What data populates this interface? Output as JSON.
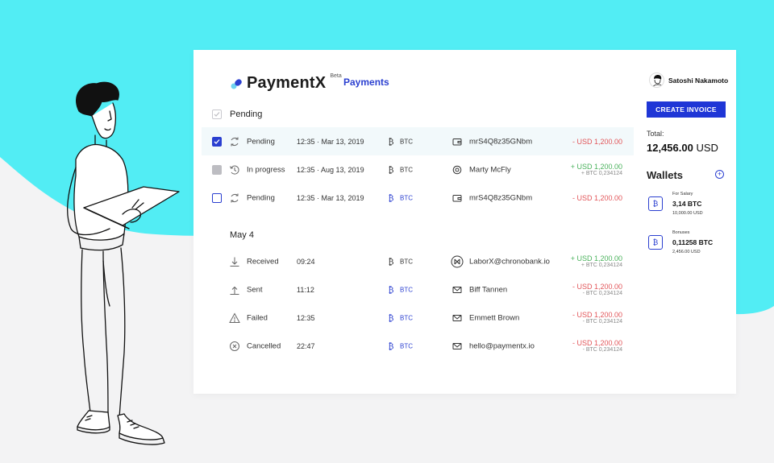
{
  "app": {
    "name": "PaymentX",
    "badge": "Beta",
    "nav_active": "Payments"
  },
  "groups": [
    {
      "title": "Pending"
    },
    {
      "title": "May 4"
    }
  ],
  "pending_rows": [
    {
      "status": "Pending",
      "time": "12:35 · Mar 13, 2019",
      "currency": "BTC",
      "party": "mrS4Q8z35GNbm",
      "amount": "- USD 1,200.00",
      "sub": ""
    },
    {
      "status": "In progress",
      "time": "12:35 · Aug 13, 2019",
      "currency": "BTC",
      "party": "Marty McFly",
      "amount": "+ USD 1,200.00",
      "sub": "+ BTC 0,234124"
    },
    {
      "status": "Pending",
      "time": "12:35 · Mar 13, 2019",
      "currency": "BTC",
      "party": "mrS4Q8z35GNbm",
      "amount": "- USD 1,200.00",
      "sub": ""
    }
  ],
  "may_rows": [
    {
      "status": "Received",
      "time": "09:24",
      "currency": "BTC",
      "party": "LaborX@chronobank.io",
      "amount": "+ USD 1,200.00",
      "sub": "+ BTC 0,234124"
    },
    {
      "status": "Sent",
      "time": "11:12",
      "currency": "BTC",
      "party": "Biff Tannen",
      "amount": "- USD 1,200.00",
      "sub": "- BTC 0,234124"
    },
    {
      "status": "Failed",
      "time": "12:35",
      "currency": "BTC",
      "party": "Emmett Brown",
      "amount": "- USD 1,200.00",
      "sub": "- BTC 0,234124"
    },
    {
      "status": "Cancelled",
      "time": "22:47",
      "currency": "BTC",
      "party": "hello@paymentx.io",
      "amount": "- USD 1,200.00",
      "sub": "- BTC 0,234124"
    }
  ],
  "sidebar": {
    "user_name": "Satoshi Nakamoto",
    "create_invoice": "CREATE INVOICE",
    "total_label": "Total:",
    "total_value": "12,456.00",
    "total_unit": "USD",
    "wallets_title": "Wallets",
    "add_symbol": "+",
    "wallets": [
      {
        "name": "For Salary",
        "amount": "3,14 BTC",
        "usd": "10,000.00 USD"
      },
      {
        "name": "Bonuses",
        "amount": "0,11258 BTC",
        "usd": "2,456.00 USD"
      }
    ]
  },
  "colors": {
    "accent": "#2a3fd0",
    "background_cyan": "#52edf4",
    "negative": "#e2565a",
    "positive": "#4ab25c"
  }
}
